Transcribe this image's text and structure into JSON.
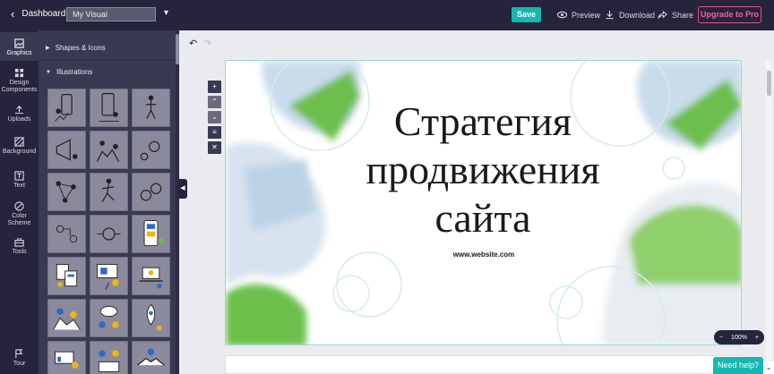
{
  "topbar": {
    "back_label": "Dashboard",
    "title_value": "My Visual",
    "save_label": "Save",
    "preview_label": "Preview",
    "download_label": "Download",
    "share_label": "Share",
    "upgrade_label": "Upgrade to Pro"
  },
  "rail": {
    "items": [
      {
        "label": "Graphics",
        "icon": "graphics-icon"
      },
      {
        "label": "Design Components",
        "icon": "components-icon"
      },
      {
        "label": "Uploads",
        "icon": "upload-icon"
      },
      {
        "label": "Background",
        "icon": "background-icon"
      },
      {
        "label": "Text",
        "icon": "text-icon"
      },
      {
        "label": "Color Scheme",
        "icon": "palette-icon"
      },
      {
        "label": "Tools",
        "icon": "toolbox-icon"
      },
      {
        "label": "Tour",
        "icon": "tour-icon"
      }
    ]
  },
  "panel": {
    "shapes_label": "Shapes & Icons",
    "illustrations_label": "Illustrations"
  },
  "slide": {
    "title_line1": "Стратегия",
    "title_line2": "продвижения",
    "title_line3": "сайта",
    "url": "www.website.com"
  },
  "zoom": {
    "value": "100%",
    "minus": "−",
    "plus": "+"
  },
  "help": {
    "label": "Need help?"
  },
  "colors": {
    "accent": "#14b8b0",
    "dark": "#25243c",
    "panel": "#3a3952",
    "upgrade": "#e84f84",
    "green": "#6cbf4c"
  }
}
